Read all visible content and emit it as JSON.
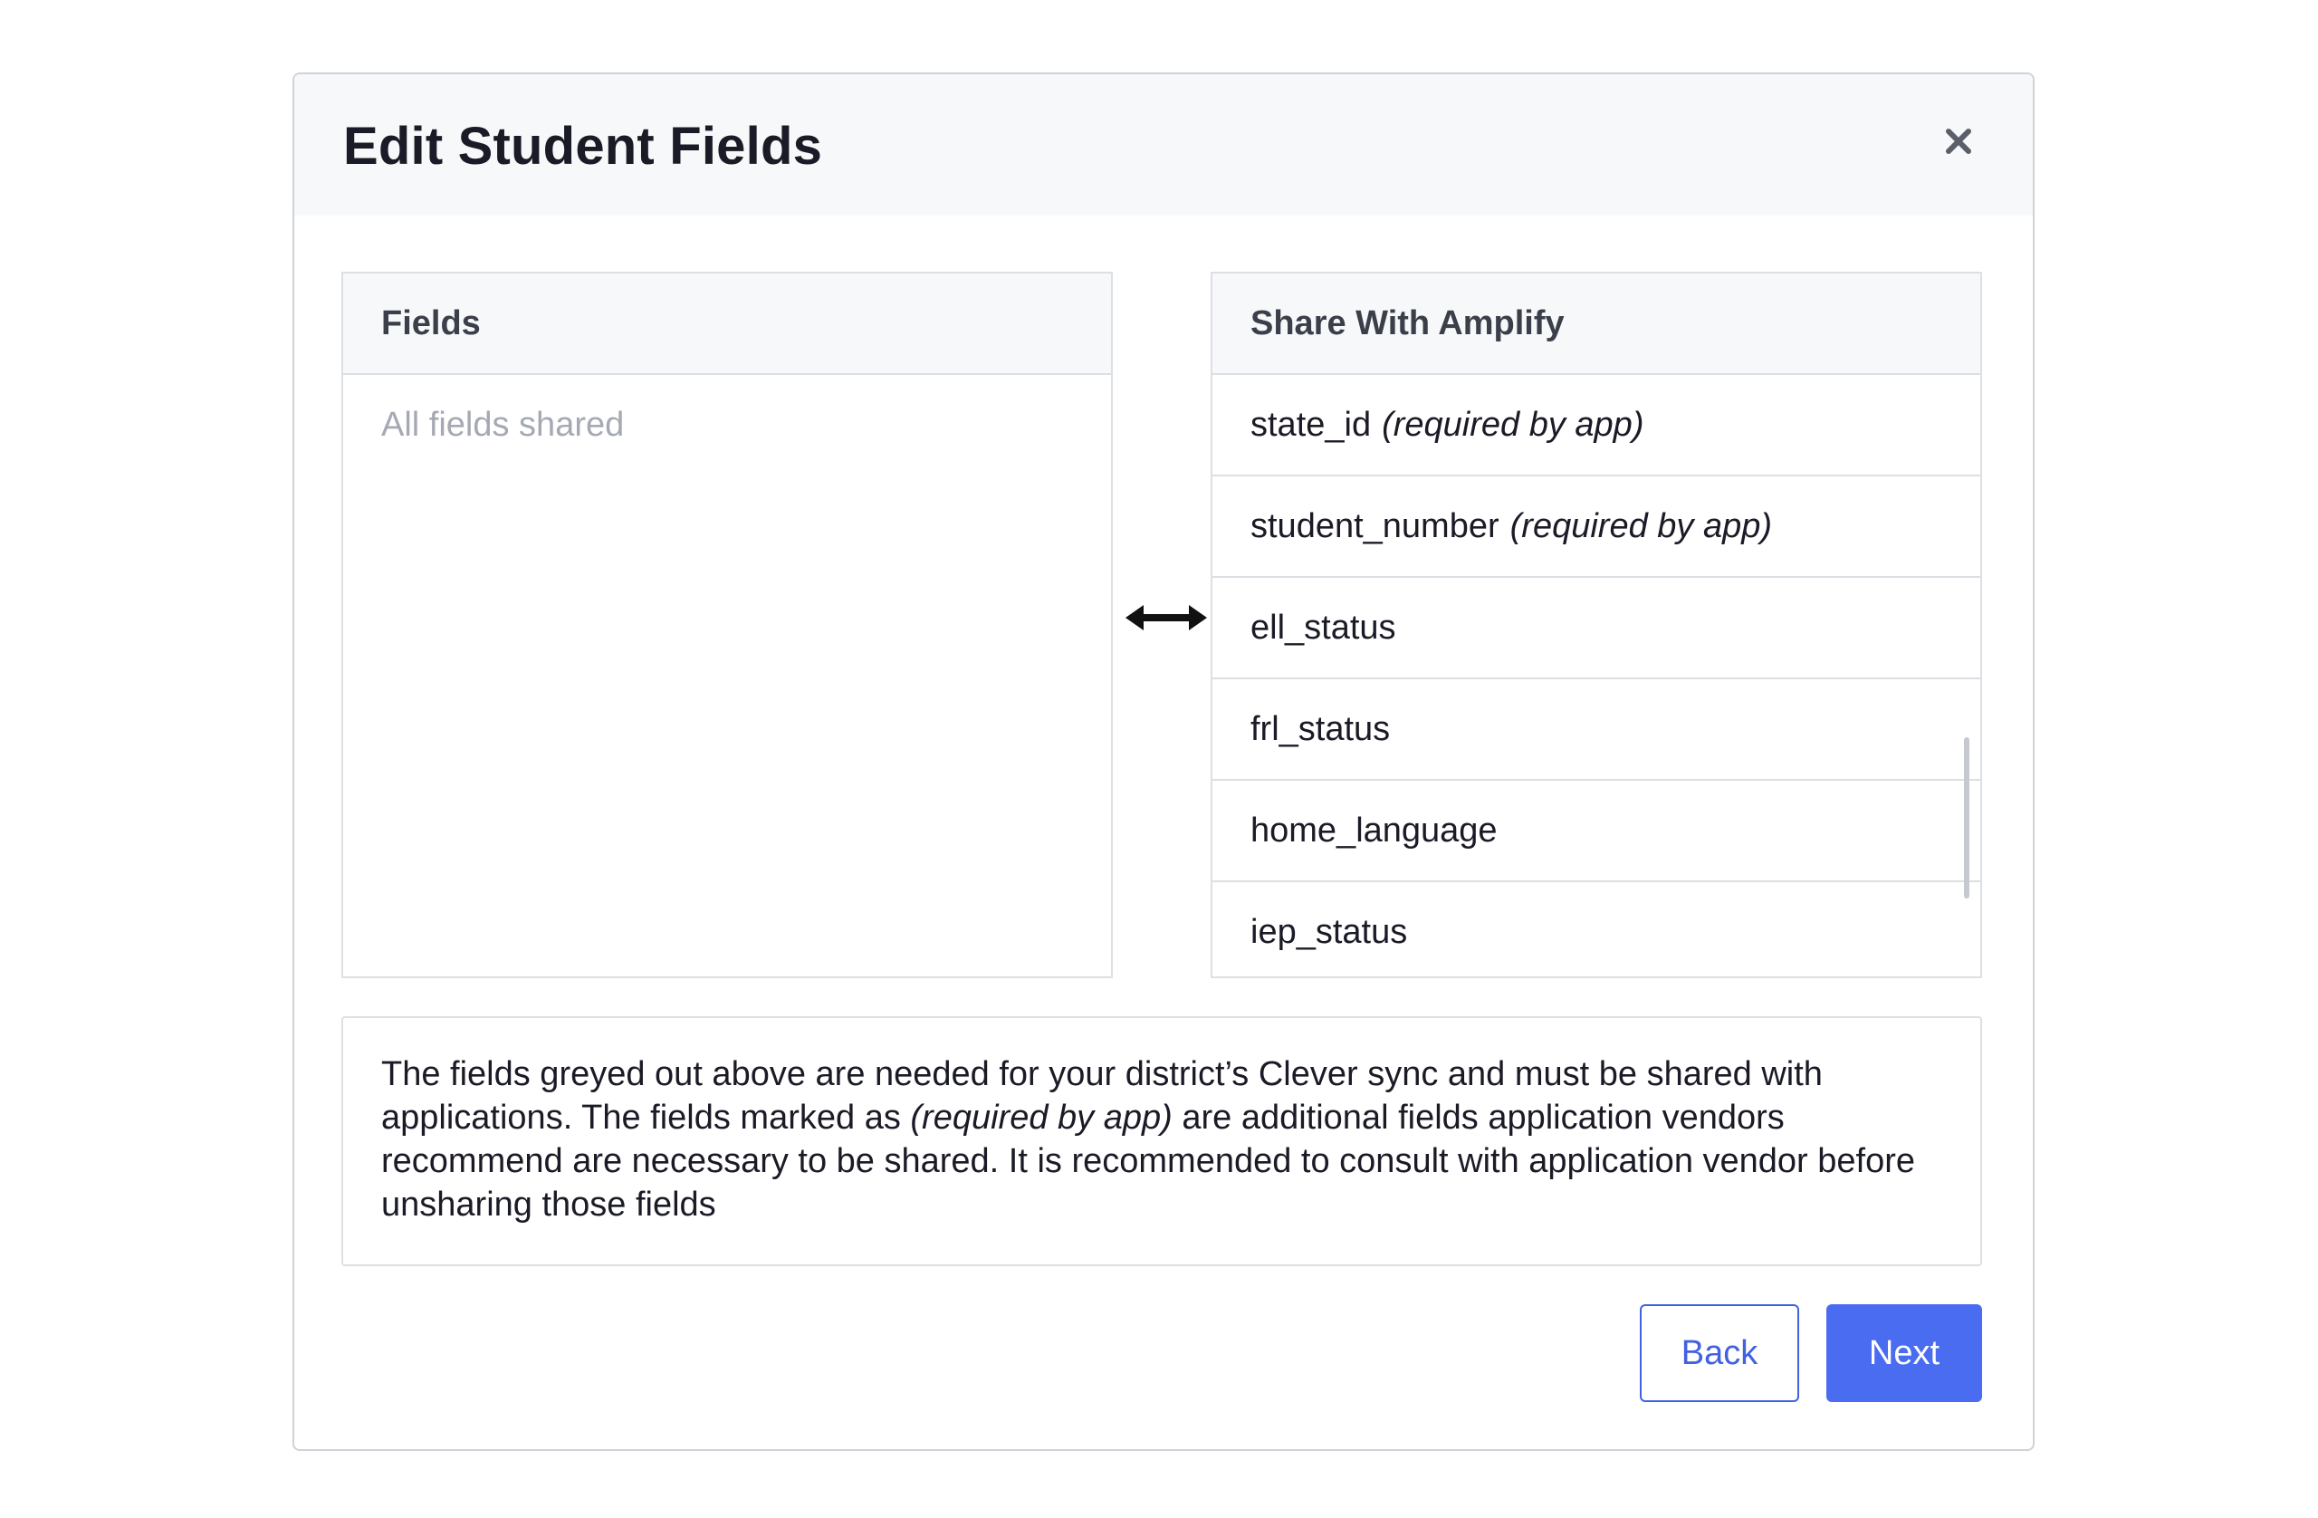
{
  "modal": {
    "title": "Edit Student Fields"
  },
  "left_panel": {
    "header": "Fields",
    "empty_text": "All fields shared"
  },
  "right_panel": {
    "header": "Share With Amplify",
    "items": [
      {
        "field": "state_id",
        "note": "(required by app)"
      },
      {
        "field": "student_number",
        "note": "(required by app)"
      },
      {
        "field": "ell_status",
        "note": ""
      },
      {
        "field": "frl_status",
        "note": ""
      },
      {
        "field": "home_language",
        "note": ""
      },
      {
        "field": "iep_status",
        "note": ""
      }
    ]
  },
  "info": {
    "part1": "The fields greyed out above are needed for your district’s Clever sync and must be shared with applications. The fields marked as",
    "required_label": "(required by app)",
    "part2": "are additional fields application vendors recommend are necessary to be shared. It is recommended to consult with application vendor before unsharing those fields"
  },
  "footer": {
    "back_label": "Back",
    "next_label": "Next"
  },
  "colors": {
    "primary": "#4a6cf0",
    "header_bg": "#f7f8fa",
    "border": "#dcdfe4",
    "muted_text": "#a4a9b3"
  },
  "icons": {
    "close": "close-icon",
    "swap": "double-arrow-icon"
  }
}
